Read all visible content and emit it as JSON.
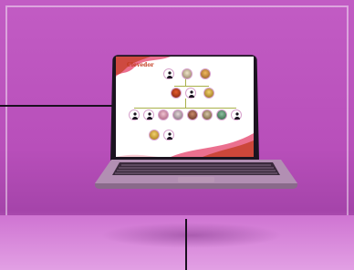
{
  "scene": {
    "colors": {
      "wall": "#b84fba",
      "floor": "#d98ddb",
      "laptop_body": "#b28fb3",
      "screen_bezel": "#1b1420",
      "callout": "#1a1020",
      "accent_red": "#c23a1e",
      "accent_pink": "#e8577b"
    }
  },
  "screen": {
    "title": "Clevedor",
    "icons": [
      "person-icon",
      "photo-icon"
    ]
  }
}
